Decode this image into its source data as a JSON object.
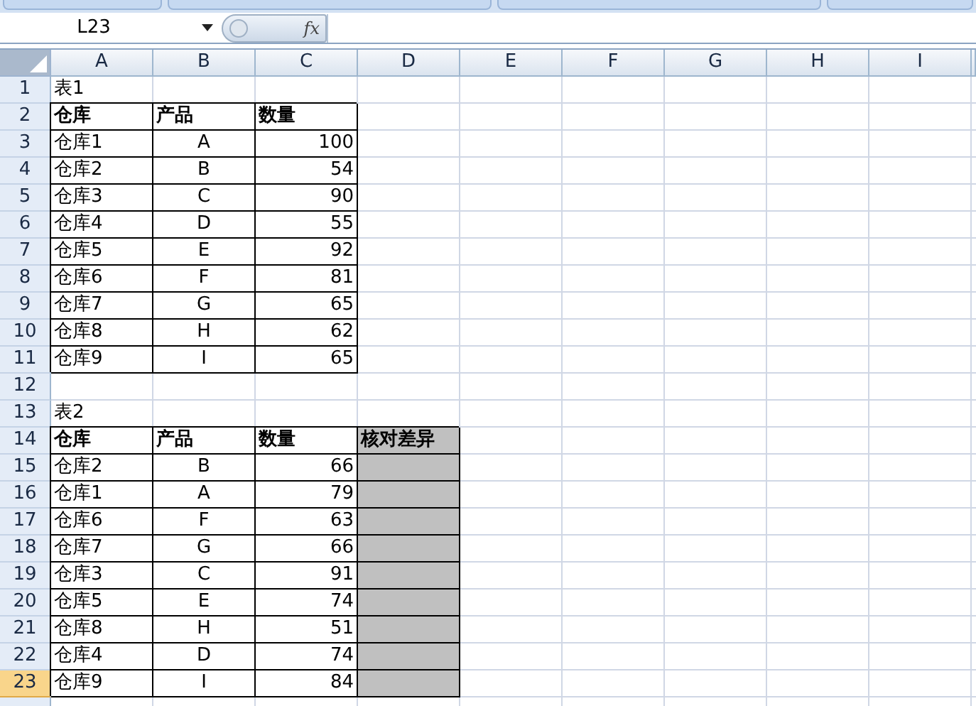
{
  "formula_bar": {
    "name_box": "L23",
    "function_label": "fx"
  },
  "columns": [
    {
      "label": "A"
    },
    {
      "label": "B"
    },
    {
      "label": "C"
    },
    {
      "label": "D"
    },
    {
      "label": "E"
    },
    {
      "label": "F"
    },
    {
      "label": "G"
    },
    {
      "label": "H"
    },
    {
      "label": "I"
    }
  ],
  "rows": [
    {
      "number": "1",
      "selected": false,
      "cells": [
        {
          "kind": "title",
          "text": "表1"
        }
      ]
    },
    {
      "number": "2",
      "selected": false,
      "cells": [
        {
          "kind": "header",
          "text": "仓库"
        },
        {
          "kind": "header",
          "text": "产品"
        },
        {
          "kind": "header",
          "text": "数量"
        }
      ]
    },
    {
      "number": "3",
      "selected": false,
      "cells": [
        {
          "kind": "name",
          "text": "仓库1"
        },
        {
          "kind": "code",
          "text": "A"
        },
        {
          "kind": "number",
          "text": "100"
        }
      ]
    },
    {
      "number": "4",
      "selected": false,
      "cells": [
        {
          "kind": "name",
          "text": "仓库2"
        },
        {
          "kind": "code",
          "text": "B"
        },
        {
          "kind": "number",
          "text": "54"
        }
      ]
    },
    {
      "number": "5",
      "selected": false,
      "cells": [
        {
          "kind": "name",
          "text": "仓库3"
        },
        {
          "kind": "code",
          "text": "C"
        },
        {
          "kind": "number",
          "text": "90"
        }
      ]
    },
    {
      "number": "6",
      "selected": false,
      "cells": [
        {
          "kind": "name",
          "text": "仓库4"
        },
        {
          "kind": "code",
          "text": "D"
        },
        {
          "kind": "number",
          "text": "55"
        }
      ]
    },
    {
      "number": "7",
      "selected": false,
      "cells": [
        {
          "kind": "name",
          "text": "仓库5"
        },
        {
          "kind": "code",
          "text": "E"
        },
        {
          "kind": "number",
          "text": "92"
        }
      ]
    },
    {
      "number": "8",
      "selected": false,
      "cells": [
        {
          "kind": "name",
          "text": "仓库6"
        },
        {
          "kind": "code",
          "text": "F"
        },
        {
          "kind": "number",
          "text": "81"
        }
      ]
    },
    {
      "number": "9",
      "selected": false,
      "cells": [
        {
          "kind": "name",
          "text": "仓库7"
        },
        {
          "kind": "code",
          "text": "G"
        },
        {
          "kind": "number",
          "text": "65"
        }
      ]
    },
    {
      "number": "10",
      "selected": false,
      "cells": [
        {
          "kind": "name",
          "text": "仓库8"
        },
        {
          "kind": "code",
          "text": "H"
        },
        {
          "kind": "number",
          "text": "62"
        }
      ]
    },
    {
      "number": "11",
      "selected": false,
      "cells": [
        {
          "kind": "name",
          "text": "仓库9"
        },
        {
          "kind": "code",
          "text": "I"
        },
        {
          "kind": "number",
          "text": "65"
        }
      ]
    },
    {
      "number": "12",
      "selected": false,
      "cells": []
    },
    {
      "number": "13",
      "selected": false,
      "cells": [
        {
          "kind": "title",
          "text": "表2"
        }
      ]
    },
    {
      "number": "14",
      "selected": false,
      "cells": [
        {
          "kind": "header",
          "text": "仓库"
        },
        {
          "kind": "header",
          "text": "产品"
        },
        {
          "kind": "header",
          "text": "数量"
        },
        {
          "kind": "check_header",
          "text": "核对差异"
        }
      ]
    },
    {
      "number": "15",
      "selected": false,
      "cells": [
        {
          "kind": "name",
          "text": "仓库2"
        },
        {
          "kind": "code",
          "text": "B"
        },
        {
          "kind": "number",
          "text": "66"
        },
        {
          "kind": "check"
        }
      ]
    },
    {
      "number": "16",
      "selected": false,
      "cells": [
        {
          "kind": "name",
          "text": "仓库1"
        },
        {
          "kind": "code",
          "text": "A"
        },
        {
          "kind": "number",
          "text": "79"
        },
        {
          "kind": "check"
        }
      ]
    },
    {
      "number": "17",
      "selected": false,
      "cells": [
        {
          "kind": "name",
          "text": "仓库6"
        },
        {
          "kind": "code",
          "text": "F"
        },
        {
          "kind": "number",
          "text": "63"
        },
        {
          "kind": "check"
        }
      ]
    },
    {
      "number": "18",
      "selected": false,
      "cells": [
        {
          "kind": "name",
          "text": "仓库7"
        },
        {
          "kind": "code",
          "text": "G"
        },
        {
          "kind": "number",
          "text": "66"
        },
        {
          "kind": "check"
        }
      ]
    },
    {
      "number": "19",
      "selected": false,
      "cells": [
        {
          "kind": "name",
          "text": "仓库3"
        },
        {
          "kind": "code",
          "text": "C"
        },
        {
          "kind": "number",
          "text": "91"
        },
        {
          "kind": "check"
        }
      ]
    },
    {
      "number": "20",
      "selected": false,
      "cells": [
        {
          "kind": "name",
          "text": "仓库5"
        },
        {
          "kind": "code",
          "text": "E"
        },
        {
          "kind": "number",
          "text": "74"
        },
        {
          "kind": "check"
        }
      ]
    },
    {
      "number": "21",
      "selected": false,
      "cells": [
        {
          "kind": "name",
          "text": "仓库8"
        },
        {
          "kind": "code",
          "text": "H"
        },
        {
          "kind": "number",
          "text": "51"
        },
        {
          "kind": "check"
        }
      ]
    },
    {
      "number": "22",
      "selected": false,
      "cells": [
        {
          "kind": "name",
          "text": "仓库4"
        },
        {
          "kind": "code",
          "text": "D"
        },
        {
          "kind": "number",
          "text": "74"
        },
        {
          "kind": "check"
        }
      ]
    },
    {
      "number": "23",
      "selected": true,
      "cells": [
        {
          "kind": "name",
          "text": "仓库9"
        },
        {
          "kind": "code",
          "text": "I"
        },
        {
          "kind": "number",
          "text": "84"
        },
        {
          "kind": "check"
        }
      ]
    }
  ]
}
